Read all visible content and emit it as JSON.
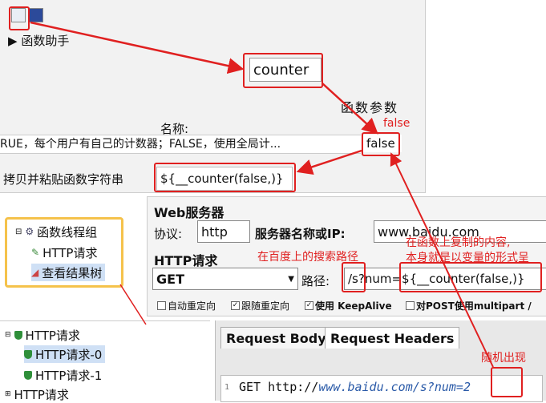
{
  "function_helper": {
    "title": "函数助手",
    "function_name": "counter",
    "params_label": "函数参数",
    "name_header": "名称:",
    "truncated_desc": "RUE，每个用户有自己的计数器；FALSE，使用全局计...",
    "param_value": "false",
    "copy_label": "拷贝并粘贴函数字符串",
    "formula": "${__counter(false,)}"
  },
  "tree_top": {
    "group": "函数线程组",
    "http_request": "HTTP请求",
    "view_results": "查看结果树"
  },
  "web_server": {
    "section_title": "Web服务器",
    "protocol_label": "协议:",
    "protocol_value": "http",
    "server_label": "服务器名称或IP:",
    "server_value": "www.baidu.com",
    "http_section": "HTTP请求",
    "method_value": "GET",
    "path_label": "路径:",
    "path_value": "/s?num=${__counter(false,)}",
    "options": [
      {
        "label": "自动重定向",
        "checked": false
      },
      {
        "label": "跟随重定向",
        "checked": true
      },
      {
        "label": "使用 KeepAlive",
        "checked": true
      },
      {
        "label": "对POST使用multipart /",
        "checked": false
      }
    ]
  },
  "tree_bottom": {
    "parent": "HTTP请求",
    "child0": "HTTP请求-0",
    "child1": "HTTP请求-1",
    "next": "HTTP请求"
  },
  "results": {
    "tab_body": "Request Body",
    "tab_headers": "Request Headers",
    "line_no": "1",
    "request_line_prefix": "GET http://",
    "request_line_url": "www.baidu.com/s?num=2"
  },
  "annotations": {
    "false_note": "false",
    "baidu_path_note": "在百度上的搜索路径",
    "copied_note_line1": "在函数上复制的内容,",
    "copied_note_line2": "本身就是以变量的形式呈",
    "random_note": "随机出现"
  },
  "colors": {
    "annotation": "#e02020",
    "highlight_box": "#f5c24b",
    "selection": "#cfe0f5"
  }
}
